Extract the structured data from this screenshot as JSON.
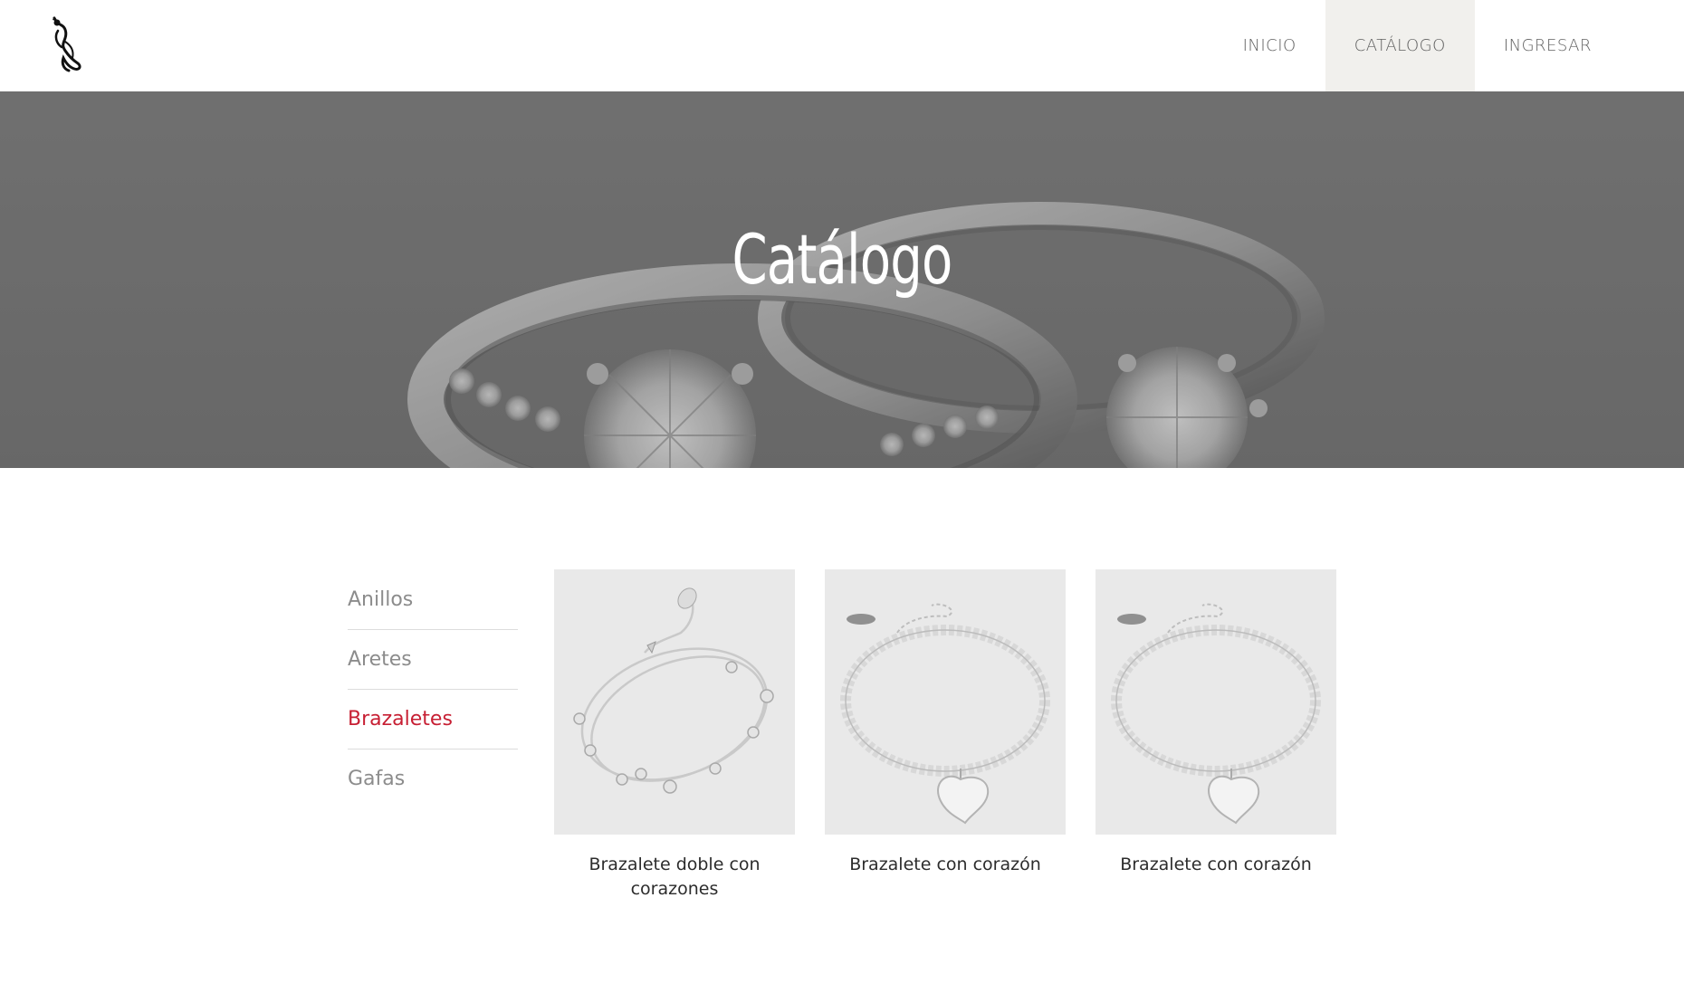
{
  "brand": {
    "logo_icon": "dancer-cat-logo-icon"
  },
  "nav": {
    "items": [
      {
        "label": "INICIO",
        "active": false
      },
      {
        "label": "CATÁLOGO",
        "active": true
      },
      {
        "label": "INGRESAR",
        "active": false
      }
    ]
  },
  "hero": {
    "title": "Catálogo",
    "image": "silver-rings-photo"
  },
  "sidebar": {
    "categories": [
      {
        "label": "Anillos",
        "active": false
      },
      {
        "label": "Aretes",
        "active": false
      },
      {
        "label": "Brazaletes",
        "active": true
      },
      {
        "label": "Gafas",
        "active": false
      }
    ],
    "active_color": "#c71f33"
  },
  "products": [
    {
      "name": "Brazalete doble con corazones",
      "image": "double-bracelet-hearts-photo"
    },
    {
      "name": "Brazalete con corazón",
      "image": "bead-bracelet-heart-photo"
    },
    {
      "name": "Brazalete con corazón",
      "image": "bead-bracelet-heart-photo"
    }
  ]
}
